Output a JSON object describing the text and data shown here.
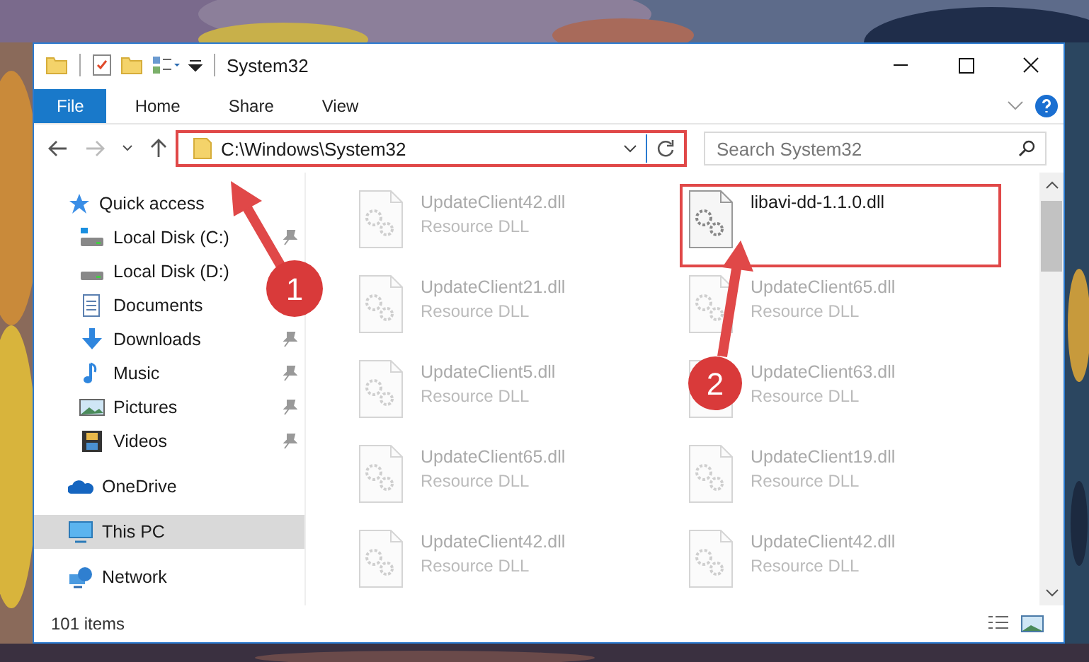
{
  "window": {
    "title": "System32"
  },
  "ribbon": {
    "tabs": [
      {
        "label": "File",
        "selected": true
      },
      {
        "label": "Home",
        "selected": false
      },
      {
        "label": "Share",
        "selected": false
      },
      {
        "label": "View",
        "selected": false
      }
    ]
  },
  "address_bar": {
    "path": "C:\\Windows\\System32",
    "highlighted": true
  },
  "search": {
    "placeholder": "Search System32"
  },
  "sidebar": {
    "items": [
      {
        "label": "Quick access",
        "kind": "star",
        "selected": false,
        "children": [
          {
            "label": "Local Disk (C:)",
            "kind": "system-disk",
            "pinned": true,
            "selected": false
          },
          {
            "label": "Local Disk (D:)",
            "kind": "disk",
            "selected": false
          },
          {
            "label": "Documents",
            "kind": "documents",
            "selected": false
          },
          {
            "label": "Downloads",
            "kind": "downloads",
            "pinned": true,
            "selected": false
          },
          {
            "label": "Music",
            "kind": "music",
            "pinned": true,
            "selected": false
          },
          {
            "label": "Pictures",
            "kind": "pictures",
            "pinned": true,
            "selected": false
          },
          {
            "label": "Videos",
            "kind": "videos",
            "pinned": true,
            "selected": false
          }
        ]
      },
      {
        "label": "OneDrive",
        "kind": "cloud",
        "selected": false
      },
      {
        "label": "This PC",
        "kind": "pc",
        "selected": true
      },
      {
        "label": "Network",
        "kind": "network",
        "selected": false
      }
    ]
  },
  "files": [
    {
      "name": "UpdateClient42.dll",
      "type": "Resource DLL",
      "blurred": true,
      "highlighted": false
    },
    {
      "name": "libavi-dd-1.1.0.dll",
      "blurred": false,
      "highlighted": true
    },
    {
      "name": "UpdateClient21.dll",
      "type": "Resource DLL",
      "blurred": true,
      "highlighted": false
    },
    {
      "name": "UpdateClient65.dll",
      "type": "Resource DLL",
      "blurred": true,
      "highlighted": false
    },
    {
      "name": "UpdateClient5.dll",
      "type": "Resource DLL",
      "blurred": true,
      "highlighted": false
    },
    {
      "name": "UpdateClient63.dll",
      "type": "Resource DLL",
      "blurred": true,
      "highlighted": false
    },
    {
      "name": "UpdateClient65.dll",
      "type": "Resource DLL",
      "blurred": true,
      "highlighted": false
    },
    {
      "name": "UpdateClient19.dll",
      "type": "Resource DLL",
      "blurred": true,
      "highlighted": false
    },
    {
      "name": "UpdateClient42.dll",
      "type": "Resource DLL",
      "blurred": true,
      "highlighted": false
    },
    {
      "name": "UpdateClient42.dll",
      "type": "Resource DLL",
      "blurred": true,
      "highlighted": false
    }
  ],
  "status_bar": {
    "item_count": "101 items"
  },
  "annotations": [
    {
      "label": "1"
    },
    {
      "label": "2"
    }
  ]
}
